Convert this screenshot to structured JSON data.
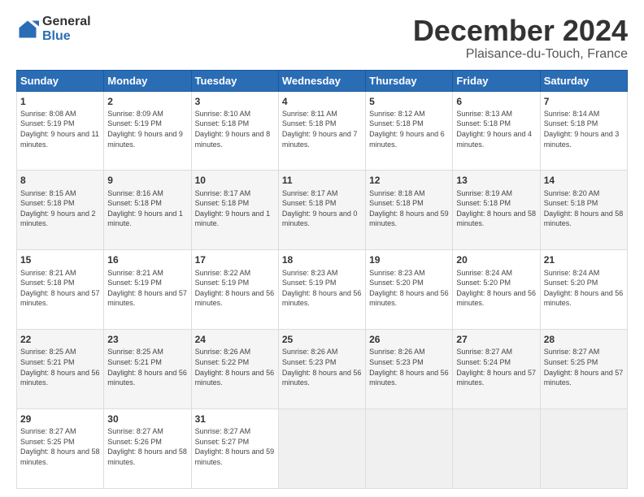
{
  "header": {
    "logo_general": "General",
    "logo_blue": "Blue",
    "month_title": "December 2024",
    "subtitle": "Plaisance-du-Touch, France"
  },
  "days_of_week": [
    "Sunday",
    "Monday",
    "Tuesday",
    "Wednesday",
    "Thursday",
    "Friday",
    "Saturday"
  ],
  "weeks": [
    [
      {
        "day": "1",
        "sunrise": "8:08 AM",
        "sunset": "5:19 PM",
        "daylight": "9 hours and 11 minutes."
      },
      {
        "day": "2",
        "sunrise": "8:09 AM",
        "sunset": "5:19 PM",
        "daylight": "9 hours and 9 minutes."
      },
      {
        "day": "3",
        "sunrise": "8:10 AM",
        "sunset": "5:18 PM",
        "daylight": "9 hours and 8 minutes."
      },
      {
        "day": "4",
        "sunrise": "8:11 AM",
        "sunset": "5:18 PM",
        "daylight": "9 hours and 7 minutes."
      },
      {
        "day": "5",
        "sunrise": "8:12 AM",
        "sunset": "5:18 PM",
        "daylight": "9 hours and 6 minutes."
      },
      {
        "day": "6",
        "sunrise": "8:13 AM",
        "sunset": "5:18 PM",
        "daylight": "9 hours and 4 minutes."
      },
      {
        "day": "7",
        "sunrise": "8:14 AM",
        "sunset": "5:18 PM",
        "daylight": "9 hours and 3 minutes."
      }
    ],
    [
      {
        "day": "8",
        "sunrise": "8:15 AM",
        "sunset": "5:18 PM",
        "daylight": "9 hours and 2 minutes."
      },
      {
        "day": "9",
        "sunrise": "8:16 AM",
        "sunset": "5:18 PM",
        "daylight": "9 hours and 1 minute."
      },
      {
        "day": "10",
        "sunrise": "8:17 AM",
        "sunset": "5:18 PM",
        "daylight": "9 hours and 1 minute."
      },
      {
        "day": "11",
        "sunrise": "8:17 AM",
        "sunset": "5:18 PM",
        "daylight": "9 hours and 0 minutes."
      },
      {
        "day": "12",
        "sunrise": "8:18 AM",
        "sunset": "5:18 PM",
        "daylight": "8 hours and 59 minutes."
      },
      {
        "day": "13",
        "sunrise": "8:19 AM",
        "sunset": "5:18 PM",
        "daylight": "8 hours and 58 minutes."
      },
      {
        "day": "14",
        "sunrise": "8:20 AM",
        "sunset": "5:18 PM",
        "daylight": "8 hours and 58 minutes."
      }
    ],
    [
      {
        "day": "15",
        "sunrise": "8:21 AM",
        "sunset": "5:18 PM",
        "daylight": "8 hours and 57 minutes."
      },
      {
        "day": "16",
        "sunrise": "8:21 AM",
        "sunset": "5:19 PM",
        "daylight": "8 hours and 57 minutes."
      },
      {
        "day": "17",
        "sunrise": "8:22 AM",
        "sunset": "5:19 PM",
        "daylight": "8 hours and 56 minutes."
      },
      {
        "day": "18",
        "sunrise": "8:23 AM",
        "sunset": "5:19 PM",
        "daylight": "8 hours and 56 minutes."
      },
      {
        "day": "19",
        "sunrise": "8:23 AM",
        "sunset": "5:20 PM",
        "daylight": "8 hours and 56 minutes."
      },
      {
        "day": "20",
        "sunrise": "8:24 AM",
        "sunset": "5:20 PM",
        "daylight": "8 hours and 56 minutes."
      },
      {
        "day": "21",
        "sunrise": "8:24 AM",
        "sunset": "5:20 PM",
        "daylight": "8 hours and 56 minutes."
      }
    ],
    [
      {
        "day": "22",
        "sunrise": "8:25 AM",
        "sunset": "5:21 PM",
        "daylight": "8 hours and 56 minutes."
      },
      {
        "day": "23",
        "sunrise": "8:25 AM",
        "sunset": "5:21 PM",
        "daylight": "8 hours and 56 minutes."
      },
      {
        "day": "24",
        "sunrise": "8:26 AM",
        "sunset": "5:22 PM",
        "daylight": "8 hours and 56 minutes."
      },
      {
        "day": "25",
        "sunrise": "8:26 AM",
        "sunset": "5:23 PM",
        "daylight": "8 hours and 56 minutes."
      },
      {
        "day": "26",
        "sunrise": "8:26 AM",
        "sunset": "5:23 PM",
        "daylight": "8 hours and 56 minutes."
      },
      {
        "day": "27",
        "sunrise": "8:27 AM",
        "sunset": "5:24 PM",
        "daylight": "8 hours and 57 minutes."
      },
      {
        "day": "28",
        "sunrise": "8:27 AM",
        "sunset": "5:25 PM",
        "daylight": "8 hours and 57 minutes."
      }
    ],
    [
      {
        "day": "29",
        "sunrise": "8:27 AM",
        "sunset": "5:25 PM",
        "daylight": "8 hours and 58 minutes."
      },
      {
        "day": "30",
        "sunrise": "8:27 AM",
        "sunset": "5:26 PM",
        "daylight": "8 hours and 58 minutes."
      },
      {
        "day": "31",
        "sunrise": "8:27 AM",
        "sunset": "5:27 PM",
        "daylight": "8 hours and 59 minutes."
      },
      null,
      null,
      null,
      null
    ]
  ]
}
